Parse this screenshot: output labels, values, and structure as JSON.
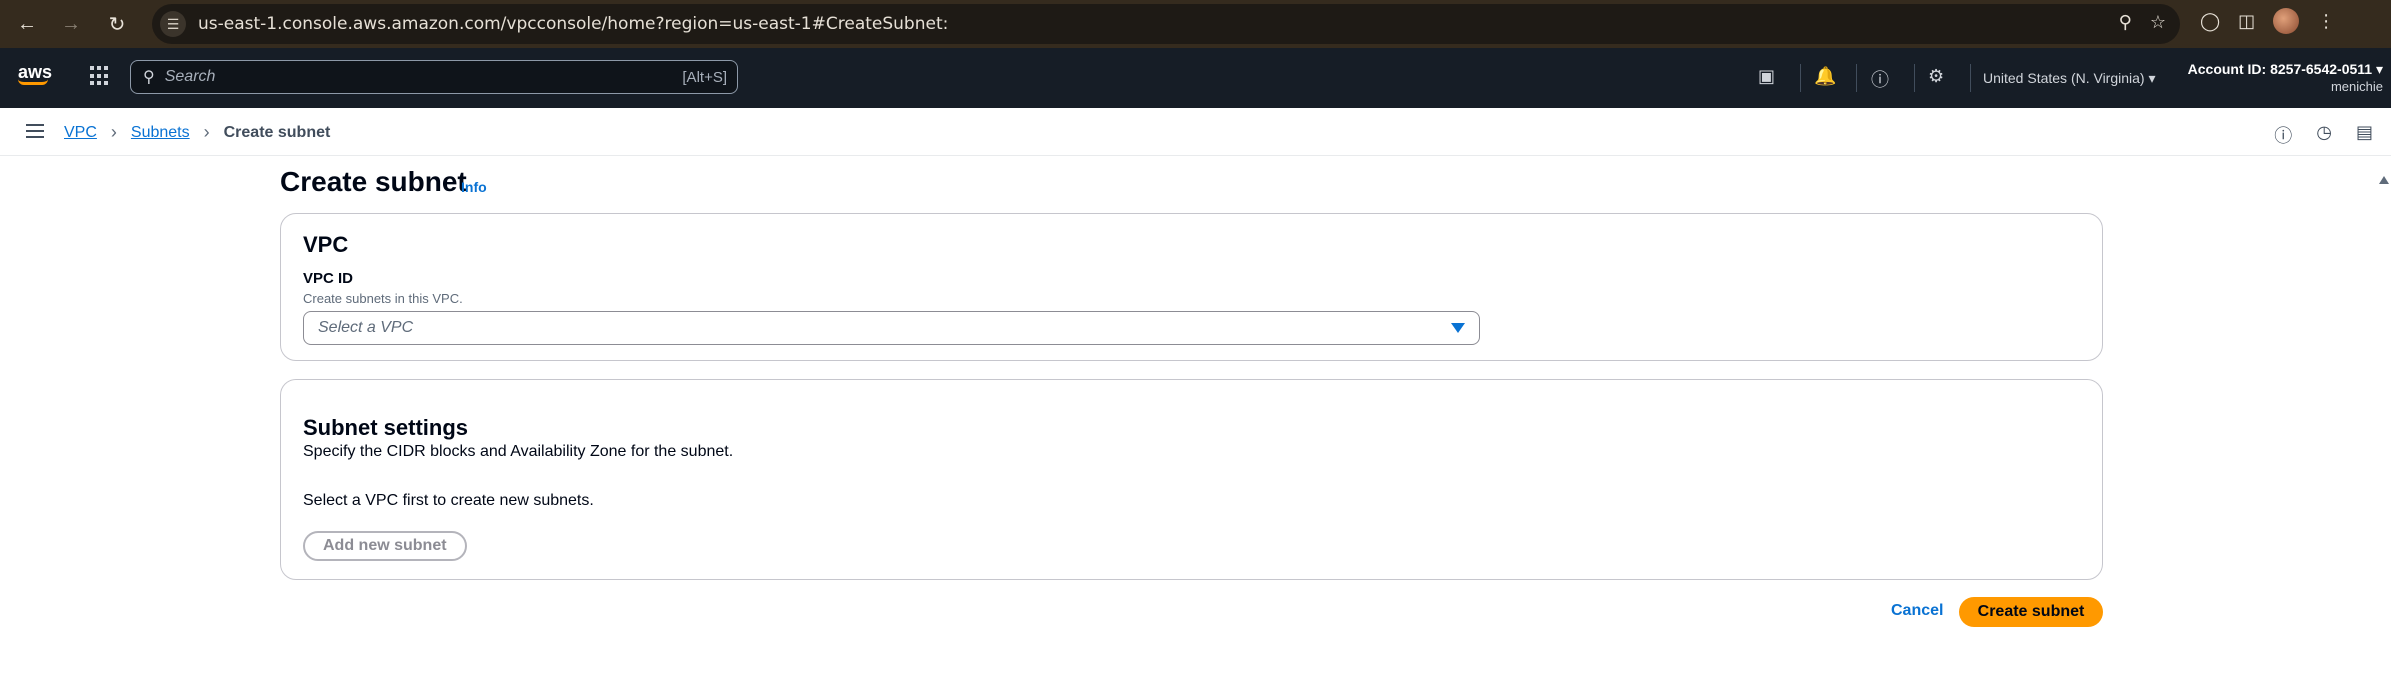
{
  "browser": {
    "url": "us-east-1.console.aws.amazon.com/vpcconsole/home?region=us-east-1#CreateSubnet:",
    "back_icon": "arrow-left-icon",
    "forward_icon": "arrow-right-icon",
    "reload_icon": "reload-icon"
  },
  "aws_nav": {
    "logo": "aws",
    "search_placeholder": "Search",
    "search_shortcut": "[Alt+S]",
    "region": "United States (N. Virginia)",
    "account": "Account ID: 8257-6542-0511",
    "user": "menichie"
  },
  "breadcrumb": {
    "items": [
      "VPC",
      "Subnets"
    ],
    "current": "Create subnet"
  },
  "page": {
    "title": "Create subnet",
    "info": "Info"
  },
  "vpc_panel": {
    "heading": "VPC",
    "field_label": "VPC ID",
    "field_description": "Create subnets in this VPC.",
    "select_placeholder": "Select a VPC"
  },
  "subnet_panel": {
    "heading": "Subnet settings",
    "description": "Specify the CIDR blocks and Availability Zone for the subnet.",
    "hint": "Select a VPC first to create new subnets.",
    "add_button": "Add new subnet"
  },
  "actions": {
    "cancel": "Cancel",
    "submit": "Create subnet"
  },
  "colors": {
    "primary": "#ff9900",
    "link": "#0972d3",
    "nav_bg": "#161d26"
  }
}
